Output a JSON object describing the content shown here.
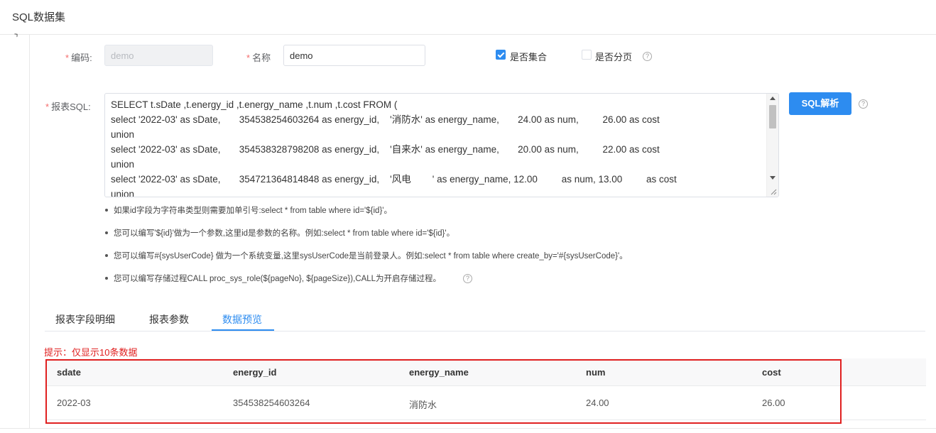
{
  "header": {
    "title": "SQL数据集"
  },
  "form": {
    "code_label": "编码:",
    "code_value": "demo",
    "name_label": "名称",
    "name_value": "demo",
    "is_collection_label": "是否集合",
    "is_collection_checked": true,
    "is_paged_label": "是否分页",
    "is_paged_checked": false,
    "sql_label": "报表SQL:",
    "sql_lines": [
      "SELECT t.sDate ,t.energy_id ,t.energy_name ,t.num ,t.cost FROM (",
      "select '2022-03' as sDate,       354538254603264 as energy_id,    '消防水' as energy_name,       24.00 as num,         26.00 as cost",
      "union",
      "select '2022-03' as sDate,       354538328798208 as energy_id,    '自来水' as energy_name,       20.00 as num,         22.00 as cost",
      "union",
      "select '2022-03' as sDate,       354721364814848 as energy_id,    '风电        ' as energy_name, 12.00         as num, 13.00         as cost",
      "union"
    ],
    "parse_button": "SQL解析",
    "help_glyph": "?"
  },
  "hints": [
    "如果id字段为字符串类型则需要加单引号:select * from table where id='${id}'。",
    "您可以编写'${id}'做为一个参数,这里id是参数的名称。例如:select * from table where id='${id}'。",
    "您可以编写#{sysUserCode} 做为一个系统变量,这里sysUserCode是当前登录人。例如:select * from table where create_by='#{sysUserCode}'。",
    "您可以编写存储过程CALL proc_sys_role(${pageNo}, ${pageSize}),CALL为开启存储过程。"
  ],
  "tabs": [
    {
      "label": "报表字段明细",
      "active": false
    },
    {
      "label": "报表参数",
      "active": false
    },
    {
      "label": "数据预览",
      "active": true
    }
  ],
  "notice": "提示：仅显示10条数据",
  "table": {
    "columns": [
      "sdate",
      "energy_id",
      "energy_name",
      "num",
      "cost"
    ],
    "rows": [
      [
        "2022-03",
        "354538254603264",
        "消防水",
        "24.00",
        "26.00"
      ]
    ]
  },
  "colors": {
    "primary": "#2d8cf0",
    "danger": "#e02020"
  }
}
